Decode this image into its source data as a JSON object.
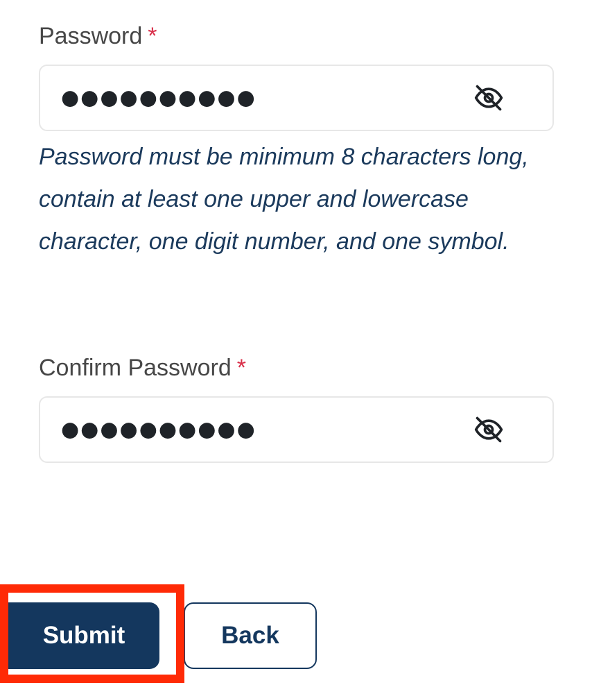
{
  "form": {
    "password": {
      "label": "Password",
      "required_mark": "*",
      "value": "●●●●●●●●●●",
      "toggle_icon": "eye-off-icon",
      "hint": "Password must be minimum 8 characters long, contain at least one upper and lowercase character, one digit number, and one symbol."
    },
    "confirm_password": {
      "label": "Confirm Password",
      "required_mark": "*",
      "value": "●●●●●●●●●●",
      "toggle_icon": "eye-off-icon"
    }
  },
  "actions": {
    "submit_label": "Submit",
    "back_label": "Back"
  },
  "colors": {
    "primary": "#14375e",
    "required": "#d9304a",
    "hint_text": "#1b3a5c",
    "highlight": "#ff2a06"
  }
}
